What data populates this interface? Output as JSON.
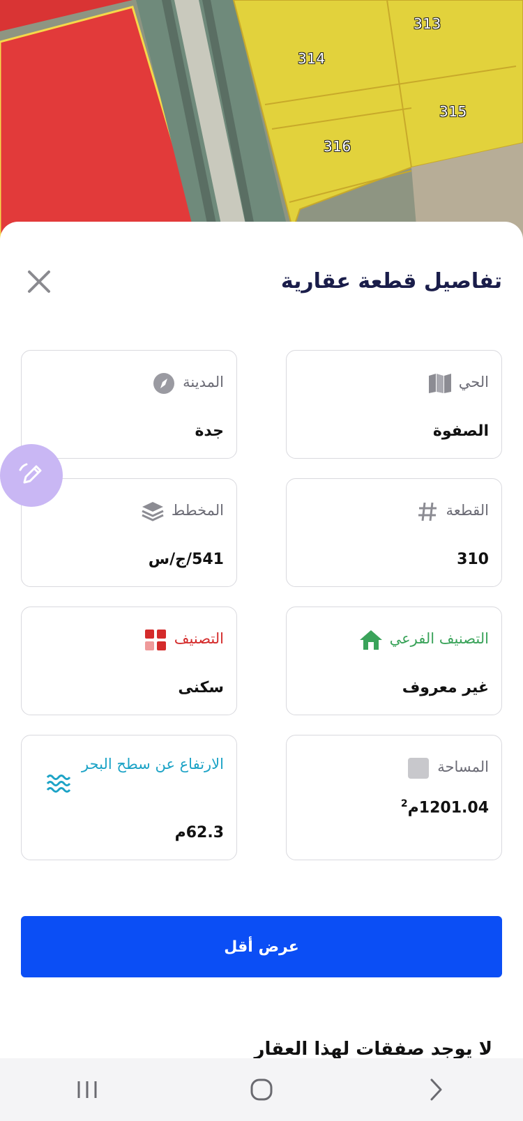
{
  "map": {
    "parcels": [
      "313",
      "314",
      "315",
      "316"
    ]
  },
  "sheet": {
    "title": "تفاصيل قطعة عقارية",
    "close_icon": "close-icon"
  },
  "cards": {
    "district": {
      "label": "الحي",
      "value": "الصفوة",
      "icon": "map-icon"
    },
    "city": {
      "label": "المدينة",
      "value": "جدة",
      "icon": "compass-icon"
    },
    "plot": {
      "label": "القطعة",
      "value": "310",
      "icon": "hash-icon"
    },
    "plan": {
      "label": "المخطط",
      "value": "541/ج/س",
      "icon": "layers-icon"
    },
    "subclass": {
      "label": "التصنيف الفرعي",
      "value": "غير معروف",
      "icon": "home-icon",
      "color": "#3aa35a"
    },
    "classification": {
      "label": "التصنيف",
      "value": "سكنى",
      "icon": "grid-icon",
      "color": "#d42b2b"
    },
    "area": {
      "label": "المساحة",
      "value": "1201.04م",
      "superscript": "2",
      "icon": "square-icon"
    },
    "elevation": {
      "label": "الارتفاع عن سطح البحر",
      "value": "62.3م",
      "icon": "waves-icon",
      "color": "#1ca3c6"
    }
  },
  "buttons": {
    "show_less": "عرض أقل"
  },
  "footer": {
    "no_deals": "لا يوجد صفقات لهذا العقار"
  },
  "colors": {
    "primary": "#0b4ef5",
    "title": "#1a1d4a"
  }
}
